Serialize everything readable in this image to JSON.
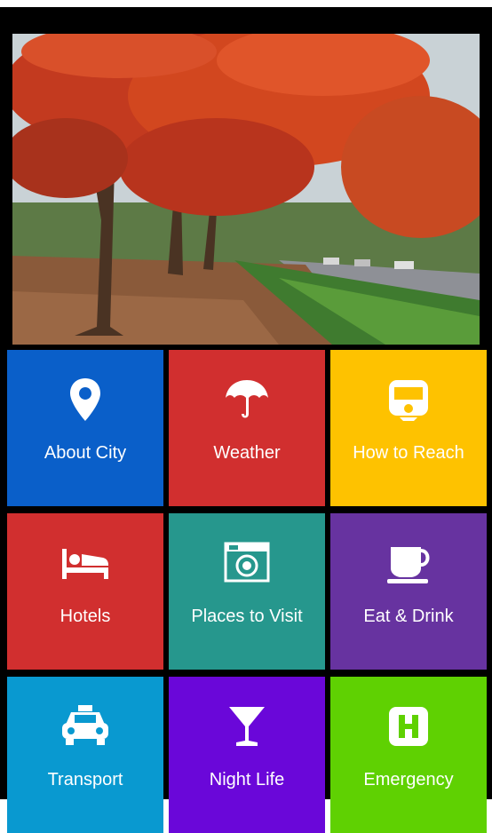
{
  "tiles": [
    {
      "label": "About City",
      "icon": "map-pin-icon",
      "color": "#0a5fc9"
    },
    {
      "label": "Weather",
      "icon": "umbrella-icon",
      "color": "#d12f2f"
    },
    {
      "label": "How to Reach",
      "icon": "train-icon",
      "color": "#fec200"
    },
    {
      "label": "Hotels",
      "icon": "bed-icon",
      "color": "#d12f2f"
    },
    {
      "label": "Places to Visit",
      "icon": "camera-icon",
      "color": "#26978d"
    },
    {
      "label": "Eat & Drink",
      "icon": "coffee-cup-icon",
      "color": "#6733a0"
    },
    {
      "label": "Transport",
      "icon": "taxi-icon",
      "color": "#0999d0"
    },
    {
      "label": "Night Life",
      "icon": "cocktail-glass-icon",
      "color": "#6a07d9"
    },
    {
      "label": "Emergency",
      "icon": "hospital-icon",
      "color": "#5fd102"
    }
  ],
  "hero": {
    "description_icon": "city-photo"
  }
}
